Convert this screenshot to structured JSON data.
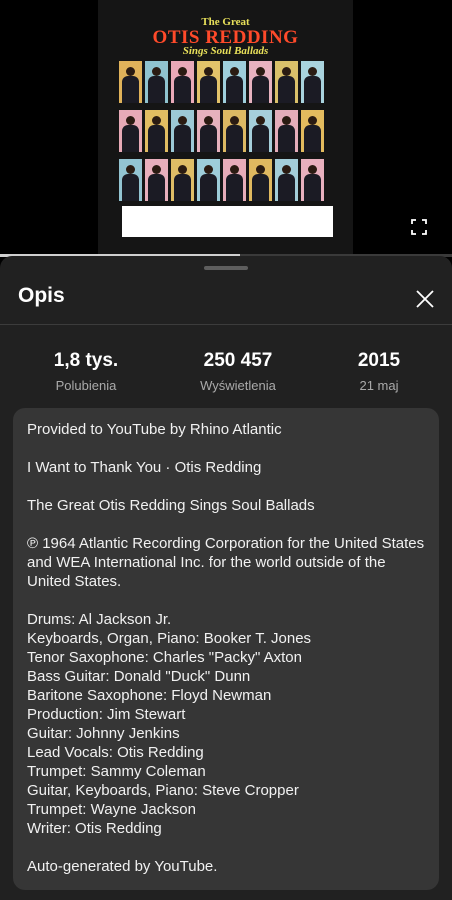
{
  "album_cover": {
    "line1": "The Great",
    "line2": "OTIS REDDING",
    "line3": "Sings Soul Ballads",
    "tile_colors": [
      "#e0b25a",
      "#8fc3cf",
      "#e9a9b8",
      "#e3c36a",
      "#9fcfdc",
      "#e8b3c0",
      "#d9c06a",
      "#a9d3dd",
      "#e7aab7",
      "#e1bd62",
      "#9cc9d6",
      "#e6b1bd",
      "#dcb963",
      "#a6cfdb",
      "#e5adba",
      "#e3bb5e",
      "#93c4d2",
      "#e8afbc",
      "#dfbd66",
      "#9ecdd9",
      "#e6acb9",
      "#e0b960",
      "#a3cdd8",
      "#e8b0be"
    ]
  },
  "player": {
    "fullscreen_icon": "fullscreen-icon",
    "progress_fraction": 0.53
  },
  "sheet": {
    "title": "Opis",
    "close_icon": "close-icon",
    "stats": [
      {
        "value": "1,8 tys.",
        "label": "Polubienia"
      },
      {
        "value": "250 457",
        "label": "Wyświetlenia"
      },
      {
        "value": "2015",
        "label": "21 maj"
      }
    ],
    "description": {
      "provided_by": "Provided to YouTube by Rhino Atlantic",
      "track": "I Want to Thank You · Otis Redding",
      "album": "The Great Otis Redding Sings Soul Ballads",
      "copyright": "℗ 1964 Atlantic Recording Corporation for the United States and WEA International Inc. for the world outside of the United States.",
      "credits": [
        "Drums: Al Jackson Jr.",
        "Keyboards, Organ, Piano: Booker T. Jones",
        "Tenor  Saxophone: Charles \"Packy\" Axton",
        "Bass  Guitar: Donald \"Duck\" Dunn",
        "Baritone  Saxophone: Floyd Newman",
        "Production: Jim Stewart",
        "Guitar: Johnny Jenkins",
        "Lead  Vocals: Otis Redding",
        "Trumpet: Sammy Coleman",
        "Guitar, Keyboards, Piano: Steve Cropper",
        "Trumpet: Wayne Jackson",
        "Writer: Otis Redding"
      ],
      "footer": "Auto-generated by YouTube."
    }
  }
}
